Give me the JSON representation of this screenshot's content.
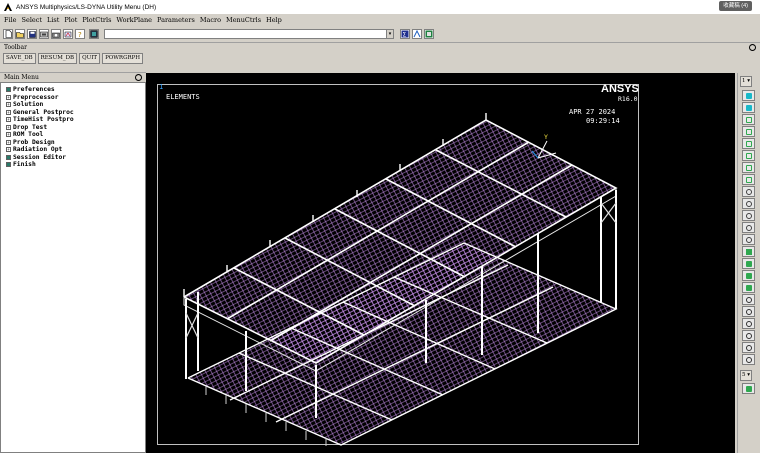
{
  "window": {
    "title": "ANSYS Multiphysics/LS-DYNA Utility Menu (DH)",
    "badge": "收藏稿 (4)"
  },
  "menu": [
    "File",
    "Select",
    "List",
    "Plot",
    "PlotCtrls",
    "WorkPlane",
    "Parameters",
    "Macro",
    "MenuCtrls",
    "Help"
  ],
  "command_input": {
    "value": ""
  },
  "toolbar": {
    "label": "Toolbar",
    "buttons": [
      "SAVE_DB",
      "RESUM_DB",
      "QUIT",
      "POWRGRPH"
    ]
  },
  "main_menu": {
    "label": "Main Menu",
    "items": [
      "Preferences",
      "Preprocessor",
      "Solution",
      "General Postproc",
      "TimeHist Postpro",
      "Drop Test",
      "ROM Tool",
      "Prob Design",
      "Radiation Opt",
      "Session Editor",
      "Finish"
    ]
  },
  "graphics": {
    "window_number": "1",
    "plot_label": "ELEMENTS",
    "logo": "ANSYS",
    "version": "R16.0",
    "date": "APR 27 2024",
    "time": "09:29:14",
    "axis_label": "Y"
  },
  "right_toolbar": {
    "window_select": "1",
    "icons": [
      "isometric-view-icon",
      "oblique-view-icon",
      "front-view-icon",
      "top-view-icon",
      "back-view-icon",
      "bottom-view-icon",
      "left-view-icon",
      "right-view-icon",
      "zoom-icon",
      "zoom-box-icon",
      "zoom-back-icon",
      "zoom-in-icon",
      "zoom-out-icon",
      "pan-left-icon",
      "pan-right-icon",
      "pan-up-icon",
      "pan-down-icon",
      "rotate-x-icon",
      "rotate-y-icon",
      "rotate-z-icon",
      "rotate-x-neg-icon",
      "rotate-y-neg-icon",
      "rotate-z-neg-icon",
      "fit-icon"
    ],
    "rate_select": "5",
    "colors": {
      "accent": "#2fa84f",
      "cyan": "#18b8c8"
    }
  },
  "colors": {
    "mesh": "#d7a6f0",
    "beams": "#ffffff",
    "background": "#000000",
    "axis": "#3aa6ff"
  }
}
